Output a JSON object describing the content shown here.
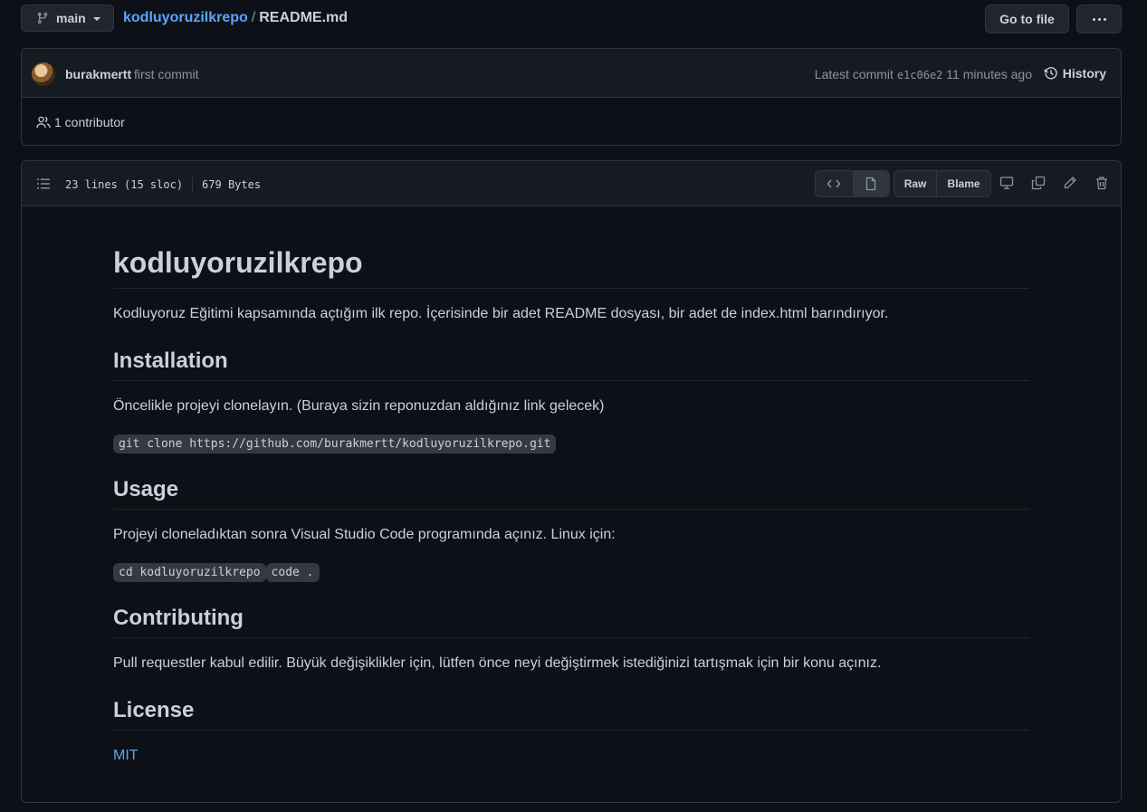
{
  "topbar": {
    "branch": "main",
    "repo": "kodluyoruzilkrepo",
    "separator": "/",
    "file": "README.md",
    "go_to_file": "Go to file"
  },
  "commit": {
    "author": "burakmertt",
    "message": "first commit",
    "latest_label": "Latest commit",
    "sha": "e1c06e2",
    "time": "11 minutes ago",
    "history": "History",
    "contributors": "1 contributor"
  },
  "file": {
    "lines": "23 lines (15 sloc)",
    "size": "679 Bytes",
    "raw": "Raw",
    "blame": "Blame"
  },
  "readme": {
    "title": "kodluyoruzilkrepo",
    "intro": "Kodluyoruz Eğitimi kapsamında açtığım ilk repo. İçerisinde bir adet README dosyası, bir adet de index.html barındırıyor.",
    "installation": {
      "heading": "Installation",
      "text": "Öncelikle projeyi clonelayın. (Buraya sizin reponuzdan aldığınız link gelecek)",
      "code": "git clone https://github.com/burakmertt/kodluyoruzilkrepo.git"
    },
    "usage": {
      "heading": "Usage",
      "text": "Projeyi cloneladıktan sonra Visual Studio Code programında açınız. Linux için:",
      "code1": "cd kodluyoruzilkrepo",
      "code2": "code ."
    },
    "contributing": {
      "heading": "Contributing",
      "text": "Pull requestler kabul edilir. Büyük değişiklikler için, lütfen önce neyi değiştirmek istediğinizi tartışmak için bir konu açınız."
    },
    "license": {
      "heading": "License",
      "link": "MIT"
    }
  },
  "colors": {
    "background": "#0d1117",
    "header": "#161b22",
    "border": "#30363d",
    "link": "#58a6ff",
    "text": "#c9d1d9",
    "muted": "#8b949e"
  },
  "icons": [
    "git-branch-icon",
    "kebab-horizontal-icon",
    "history-icon",
    "people-icon",
    "list-unordered-icon",
    "code-icon",
    "file-icon",
    "device-desktop-icon",
    "copy-icon",
    "pencil-icon",
    "trash-icon"
  ]
}
